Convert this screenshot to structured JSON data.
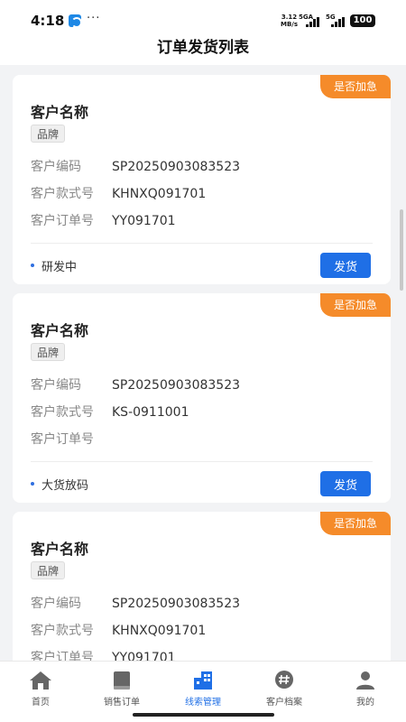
{
  "status_bar": {
    "time": "4:18",
    "dots": "···",
    "speed_top": "3.12",
    "speed_bottom": "MB/s",
    "net1": "5GA",
    "net2": "5G",
    "battery": "100"
  },
  "header": {
    "title": "订单发货列表"
  },
  "colors": {
    "accent": "#1f6fe6",
    "badge": "#f58b2a"
  },
  "orders": [
    {
      "badge": "是否加急",
      "customer_name": "客户名称",
      "brand_tag": "品牌",
      "code_label": "客户编码",
      "code_value": "SP20250903083523",
      "style_label": "客户款式号",
      "style_value": "KHNXQ091701",
      "order_label": "客户订单号",
      "order_value": "YY091701",
      "status": "研发中",
      "action": "发货"
    },
    {
      "badge": "是否加急",
      "customer_name": "客户名称",
      "brand_tag": "品牌",
      "code_label": "客户编码",
      "code_value": "SP20250903083523",
      "style_label": "客户款式号",
      "style_value": "KS-0911001",
      "order_label": "客户订单号",
      "order_value": "",
      "status": "大货放码",
      "action": "发货"
    },
    {
      "badge": "是否加急",
      "customer_name": "客户名称",
      "brand_tag": "品牌",
      "code_label": "客户编码",
      "code_value": "SP20250903083523",
      "style_label": "客户款式号",
      "style_value": "KHNXQ091701",
      "order_label": "客户订单号",
      "order_value": "YY091701",
      "status": "",
      "action": ""
    }
  ],
  "tabbar": {
    "items": [
      {
        "label": "首页",
        "icon": "home-icon"
      },
      {
        "label": "销售订单",
        "icon": "book-icon"
      },
      {
        "label": "线索管理",
        "icon": "building-icon",
        "active": true
      },
      {
        "label": "客户档案",
        "icon": "hashtag-chat-icon"
      },
      {
        "label": "我的",
        "icon": "user-icon"
      }
    ]
  }
}
